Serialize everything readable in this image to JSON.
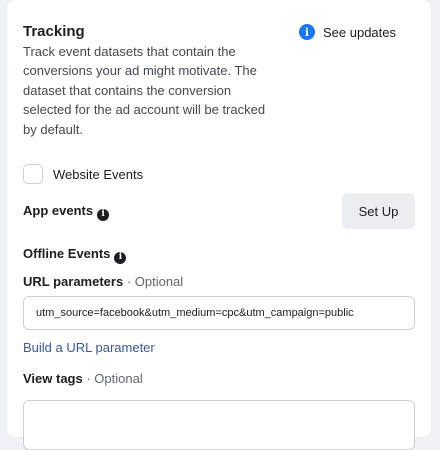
{
  "tracking": {
    "title": "Tracking",
    "description": "Track event datasets that contain the conversions your ad might motivate. The dataset that contains the conversion selected for the ad account will be tracked by default.",
    "see_updates_label": "See updates",
    "info_icon": "info-icon",
    "accent_color": "#1877f2"
  },
  "website_events": {
    "label": "Website Events",
    "checked": false
  },
  "app_events": {
    "label": "App events",
    "setup_label": "Set Up"
  },
  "offline_events": {
    "label": "Offline Events"
  },
  "url_parameters": {
    "label": "URL parameters",
    "optional": " · Optional",
    "value": "utm_source=facebook&utm_medium=cpc&utm_campaign=public",
    "build_link": "Build a URL parameter"
  },
  "view_tags": {
    "label": "View tags",
    "optional": " · Optional",
    "value": ""
  }
}
